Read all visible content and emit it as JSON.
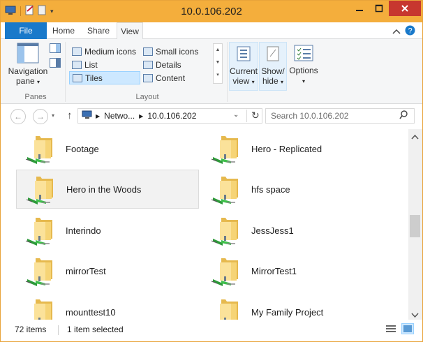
{
  "window": {
    "title": "10.0.106.202",
    "colors": {
      "titlebar": "#f4ae3c",
      "close": "#c7372f",
      "accent": "#1979ca"
    }
  },
  "tabs": {
    "file": "File",
    "home": "Home",
    "share": "Share",
    "view": "View"
  },
  "ribbon": {
    "navigation_pane": {
      "line1": "Navigation",
      "line2": "pane"
    },
    "panes_label": "Panes",
    "layout": {
      "medium_icons": "Medium icons",
      "small_icons": "Small icons",
      "list": "List",
      "details": "Details",
      "tiles": "Tiles",
      "content": "Content"
    },
    "layout_label": "Layout",
    "current_view": {
      "line1": "Current",
      "line2": "view"
    },
    "show_hide": {
      "line1": "Show/",
      "line2": "hide"
    },
    "options": "Options"
  },
  "address": {
    "crumb1": "Netwo...",
    "crumb2": "10.0.106.202",
    "search_placeholder": "Search 10.0.106.202"
  },
  "items": [
    {
      "name": "Footage"
    },
    {
      "name": "Hero - Replicated"
    },
    {
      "name": "Hero in the Woods"
    },
    {
      "name": "hfs space"
    },
    {
      "name": "Interindo"
    },
    {
      "name": "JessJess1"
    },
    {
      "name": "mirrorTest"
    },
    {
      "name": "MirrorTest1"
    },
    {
      "name": "mounttest10"
    },
    {
      "name": "My Family Project"
    }
  ],
  "selected_item": "Hero in the Woods",
  "status": {
    "count": "72 items",
    "selection": "1 item selected"
  },
  "icons": [
    "computer-icon",
    "back-icon",
    "forward-icon",
    "up-arrow-icon",
    "refresh-icon",
    "search-icon",
    "network-folder-icon"
  ]
}
